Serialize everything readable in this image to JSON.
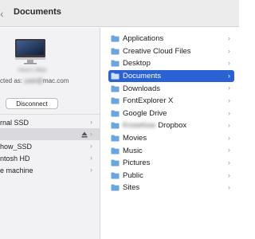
{
  "toolbar": {
    "back_glyph": "‹",
    "title": "Documents"
  },
  "device": {
    "name": "Huw's iMac",
    "connected_prefix": "cted as: ",
    "connected_user": "user@",
    "connected_domain": "mac.com",
    "disconnect_label": "Disconnect"
  },
  "volumes": [
    {
      "label": "rnal SSD",
      "selected": false,
      "eject": false
    },
    {
      "label": "",
      "selected": true,
      "eject": true
    },
    {
      "label": "how_SSD",
      "selected": false,
      "eject": false
    },
    {
      "label": "ntosh HD",
      "selected": false,
      "eject": false
    },
    {
      "label": "e machine",
      "selected": false,
      "eject": false
    }
  ],
  "folders": [
    {
      "label": "Applications",
      "icon": "folder-icon",
      "selected": false
    },
    {
      "label": "Creative Cloud Files",
      "icon": "folder-icon",
      "selected": false
    },
    {
      "label": "Desktop",
      "icon": "folder-icon",
      "selected": false
    },
    {
      "label": "Documents",
      "icon": "folder-icon",
      "selected": true
    },
    {
      "label": "Downloads",
      "icon": "folder-icon",
      "selected": false
    },
    {
      "label": "FontExplorer X",
      "icon": "folder-icon",
      "selected": false
    },
    {
      "label": "Google Drive",
      "icon": "folder-icon",
      "selected": false
    },
    {
      "label": "Dropbox",
      "blurred_prefix": "Knowhow",
      "icon": "folder-icon",
      "selected": false
    },
    {
      "label": "Movies",
      "icon": "folder-icon",
      "selected": false
    },
    {
      "label": "Music",
      "icon": "folder-icon",
      "selected": false
    },
    {
      "label": "Pictures",
      "icon": "folder-icon",
      "selected": false
    },
    {
      "label": "Public",
      "icon": "folder-icon",
      "selected": false
    },
    {
      "label": "Sites",
      "icon": "folder-icon",
      "selected": false
    }
  ],
  "chevron": "›",
  "colors": {
    "accent": "#2a62d3",
    "folder": "#6aa6e0"
  }
}
